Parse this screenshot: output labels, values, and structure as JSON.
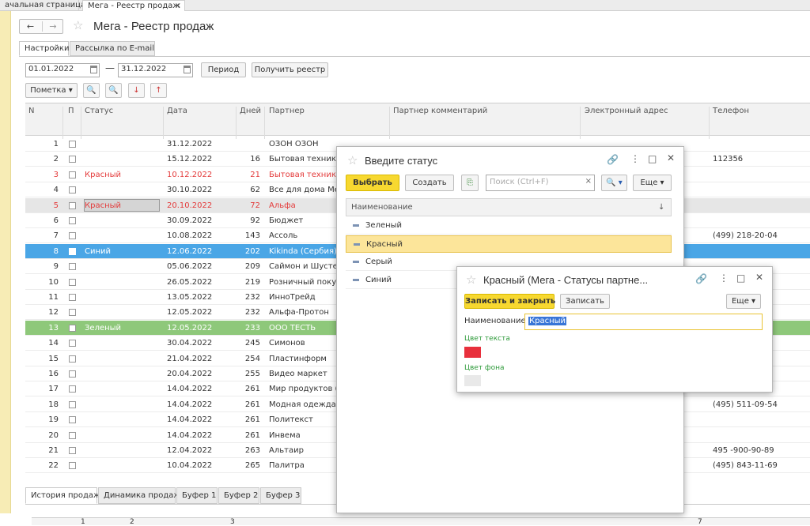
{
  "tabs": {
    "home": "ачальная страница",
    "active": "Мега - Реестр продаж",
    "close": "×"
  },
  "nav": {
    "back": "←",
    "forward": "→"
  },
  "page_title": "Мега - Реестр продаж",
  "subtabs": [
    "Настройки",
    "Рассылка по E-mail"
  ],
  "filter": {
    "date_from": "01.01.2022",
    "dash": "—",
    "date_to": "31.12.2022",
    "period_button": "Период",
    "get_registry_button": "Получить реестр"
  },
  "toolbar": {
    "mark_button": "Пометка"
  },
  "grid": {
    "headers": {
      "n": "N",
      "p": "П",
      "status": "Статус",
      "date": "Дата",
      "days": "Дней",
      "partner": "Партнер",
      "partner_comment": "Партнер комментарий",
      "email": "Электронный адрес",
      "phone": "Телефон"
    },
    "rows": [
      {
        "n": "1",
        "status": "",
        "date": "31.12.2022",
        "days": "",
        "partner": "ОЗОН ОЗОН",
        "phone": ""
      },
      {
        "n": "2",
        "status": "",
        "date": "15.12.2022",
        "days": "16",
        "partner": "Бытовая техника",
        "phone": "112356"
      },
      {
        "n": "3",
        "status": "Красный",
        "date": "10.12.2022",
        "days": "21",
        "partner": "Бытовая техника (В",
        "phone": ""
      },
      {
        "n": "4",
        "status": "",
        "date": "30.10.2022",
        "days": "62",
        "partner": "Все для дома Мега",
        "phone": ""
      },
      {
        "n": "5",
        "status": "Красный",
        "date": "20.10.2022",
        "days": "72",
        "partner": "Альфа",
        "phone": ""
      },
      {
        "n": "6",
        "status": "",
        "date": "30.09.2022",
        "days": "92",
        "partner": "Бюджет",
        "phone": ""
      },
      {
        "n": "7",
        "status": "",
        "date": "10.08.2022",
        "days": "143",
        "partner": "Ассоль",
        "phone": "(499) 218-20-04"
      },
      {
        "n": "8",
        "status": "Синий",
        "date": "12.06.2022",
        "days": "202",
        "partner": "Kikinda (Сербия)",
        "phone": ""
      },
      {
        "n": "9",
        "status": "",
        "date": "05.06.2022",
        "days": "209",
        "partner": "Саймон и Шустер",
        "phone": ""
      },
      {
        "n": "10",
        "status": "",
        "date": "26.05.2022",
        "days": "219",
        "partner": "Розничный покупат",
        "phone": ""
      },
      {
        "n": "11",
        "status": "",
        "date": "13.05.2022",
        "days": "232",
        "partner": "ИнноТрейд",
        "phone": ""
      },
      {
        "n": "12",
        "status": "",
        "date": "12.05.2022",
        "days": "232",
        "partner": "Альфа-Протон",
        "phone": ""
      },
      {
        "n": "13",
        "status": "Зеленый",
        "date": "12.05.2022",
        "days": "233",
        "partner": "ООО ТЕСТЬ",
        "phone": ""
      },
      {
        "n": "14",
        "status": "",
        "date": "30.04.2022",
        "days": "245",
        "partner": "Симонов",
        "phone": ""
      },
      {
        "n": "15",
        "status": "",
        "date": "21.04.2022",
        "days": "254",
        "partner": "Пластинформ",
        "phone": ""
      },
      {
        "n": "16",
        "status": "",
        "date": "20.04.2022",
        "days": "255",
        "partner": "Видео маркет",
        "phone": ""
      },
      {
        "n": "17",
        "status": "",
        "date": "14.04.2022",
        "days": "261",
        "partner": "Мир продуктов (Пр",
        "phone": ""
      },
      {
        "n": "18",
        "status": "",
        "date": "14.04.2022",
        "days": "261",
        "partner": "Модная одежда и",
        "phone": "(495) 511-09-54"
      },
      {
        "n": "19",
        "status": "",
        "date": "14.04.2022",
        "days": "261",
        "partner": "Политекст",
        "phone": ""
      },
      {
        "n": "20",
        "status": "",
        "date": "14.04.2022",
        "days": "261",
        "partner": "Инвема",
        "phone": ""
      },
      {
        "n": "21",
        "status": "",
        "date": "12.04.2022",
        "days": "263",
        "partner": "Альтаир",
        "phone": "495 -900-90-89"
      },
      {
        "n": "22",
        "status": "",
        "date": "10.04.2022",
        "days": "265",
        "partner": "Палитра",
        "phone": "(495) 843-11-69"
      }
    ]
  },
  "bottom_tabs": [
    "История продаж",
    "Динамика продаж",
    "Буфер 1",
    "Буфер 2",
    "Буфер 3"
  ],
  "bottom_grid_cols": [
    "1",
    "2",
    "3",
    "7"
  ],
  "status_dialog": {
    "title": "Введите статус",
    "select_button": "Выбрать",
    "create_button": "Создать",
    "search_placeholder": "Поиск (Ctrl+F)",
    "more_button": "Еще",
    "column": "Наименование",
    "sort_icon": "↓",
    "items": [
      "Зеленый",
      "Красный",
      "Серый",
      "Синий"
    ]
  },
  "item_dialog": {
    "title": "Красный (Мега - Статусы партне...",
    "save_close_button": "Записать и закрыть",
    "save_button": "Записать",
    "more_button": "Еще",
    "name_label": "Наименование:",
    "name_value": "Красный",
    "text_color_label": "Цвет текста",
    "bg_color_label": "Цвет фона",
    "text_color": "#e8303c",
    "bg_color": "#e9e9e9"
  }
}
